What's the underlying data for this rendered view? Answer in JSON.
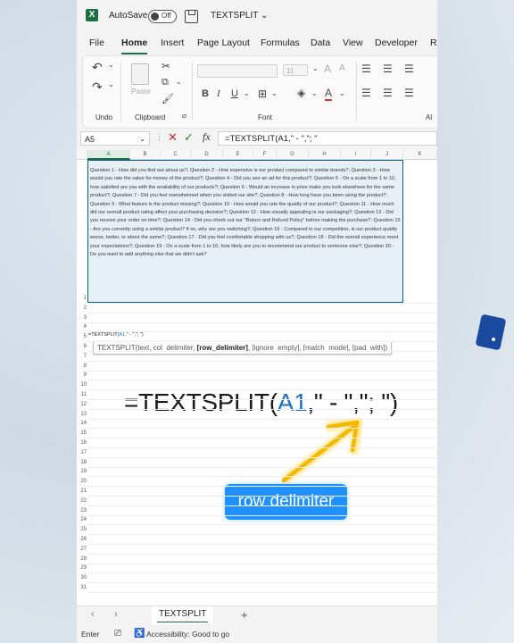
{
  "app": {
    "autosave_label": "AutoSave",
    "toggle_state": "Off",
    "file_name": "TEXTSPLIT"
  },
  "menu": {
    "tabs": [
      "File",
      "Home",
      "Insert",
      "Page Layout",
      "Formulas",
      "Data",
      "View",
      "Developer",
      "Re"
    ],
    "active": "Home"
  },
  "ribbon": {
    "groups": {
      "undo": "Undo",
      "clipboard": "Clipboard",
      "font": "Font",
      "alignment": "Al"
    },
    "paste_label": "Paste",
    "font_size_placeholder": "11"
  },
  "formula_bar": {
    "name_box": "A5",
    "formula": "=TEXTSPLIT(A1,\" - \",\"; \""
  },
  "grid": {
    "columns": [
      "A",
      "B",
      "C",
      "D",
      "E",
      "F",
      "G",
      "H",
      "I",
      "J",
      "K"
    ],
    "rows": [
      "1",
      "2",
      "3",
      "4",
      "5",
      "6",
      "7",
      "8",
      "9",
      "10",
      "11",
      "12",
      "13",
      "14",
      "15",
      "16",
      "17",
      "18",
      "19",
      "20",
      "21",
      "22",
      "23",
      "24",
      "25",
      "26",
      "27",
      "28",
      "29",
      "30",
      "31"
    ],
    "a1_text": "Question 1 - How did you find out about us?; Question 2 - How expensive is our product compared to similar brands?; Question 3 - How would you rate the value for money of the product?; Question 4 - Did you see an ad for this product?; Question 5 - On a scale from 1 to 10, how satisfied are you with the availability of our products?; Question 6 - Would an increase in price make you look elsewhere for the same product?; Question 7 - Did you feel overwhelmed when you visited our site?; Question 8 - How long have you been using the product?; Question 9 - What feature is the product missing?; Question 10 - How would you rate the quality of our product?; Question 11 - How much did our overall product rating affect your purchasing decision?; Question 12 - How visually appealing is our packaging?; Question 13 - Did you receive your order on time?; Question 14 - Did you check out our \"Return and Refund Policy\" before making the purchase?; Question 15 - Are you currently using a similar product? If so, why are you switching?; Question 16 - Compared to our competition, is our product quality worse, better, or about the same?; Question 17 - Did you feel comfortable shopping with us?; Question 18 - Did the overall experience meet your expectations?; Question 19 - On a scale from 1 to 10, how likely are you to recommend our product to someone else?; Question 20 - Do you want to add anything else that we didn't ask?",
    "a5_prefix": "=TEXTSPLIT(",
    "a5_ref": "A1",
    "a5_suffix": ",\" - \",\"; \")"
  },
  "tooltip": {
    "prefix": "TEXTSPLIT(text, col_delimiter, ",
    "bold": "[row_delimiter]",
    "suffix": ", [ignore_empty], [match_mode], [pad_with])"
  },
  "overlay": {
    "formula_prefix": "=TEXTSPLIT(",
    "formula_ref": "A1",
    "formula_suffix": ",\" - \",\"; \")",
    "callout": "row delimiter"
  },
  "sheets": {
    "active": "TEXTSPLIT",
    "add": "+"
  },
  "status": {
    "mode": "Enter",
    "accessibility": "Accessibility: Good to go"
  },
  "colors": {
    "excel_green": "#1d6f42",
    "selection_fill": "#e8f0f7",
    "ref_blue": "#1f6fc5",
    "callout_blue": "#1e90ff",
    "arrow_gold": "#f5b800"
  }
}
